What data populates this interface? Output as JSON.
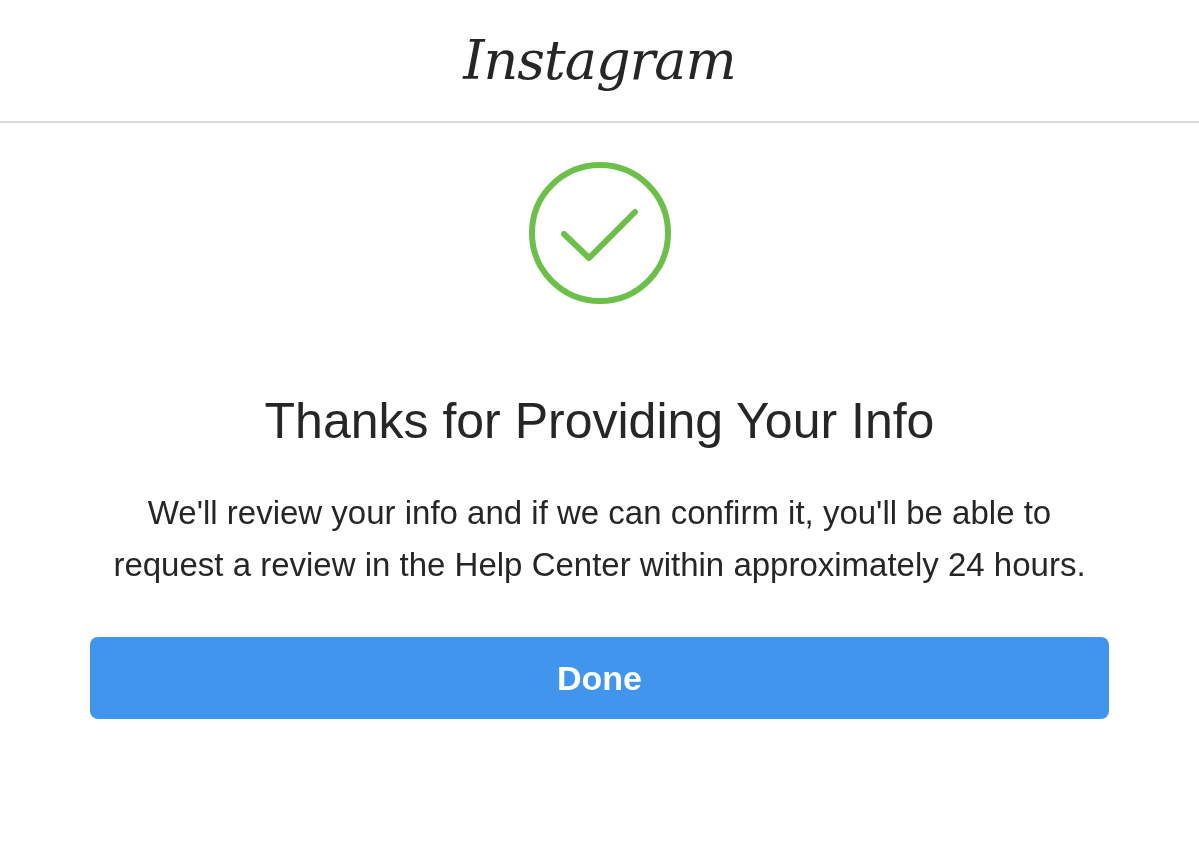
{
  "header": {
    "logo": "Instagram"
  },
  "status": {
    "kind": "success"
  },
  "title": "Thanks for Providing Your Info",
  "message": "We'll review your info and if we can confirm it, you'll be able to request a review in the Help Center within approximately 24 hours.",
  "button": {
    "label": "Done"
  }
}
